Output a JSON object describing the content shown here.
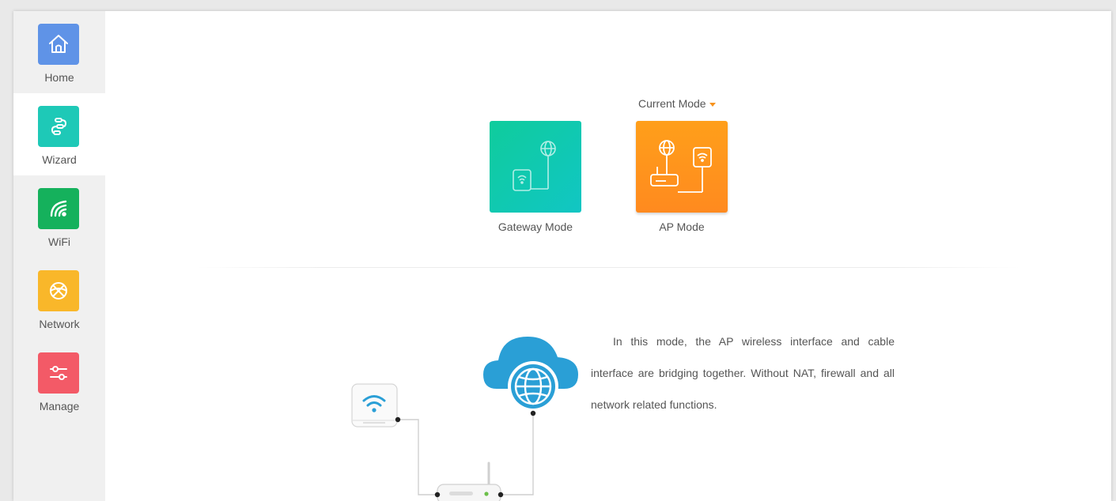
{
  "sidebar": {
    "items": [
      {
        "label": "Home",
        "icon": "home-icon",
        "color": "#5f93e7"
      },
      {
        "label": "Wizard",
        "icon": "wizard-icon",
        "color": "#1ec9b7",
        "active": true
      },
      {
        "label": "WiFi",
        "icon": "wifi-icon",
        "color": "#15b15c"
      },
      {
        "label": "Network",
        "icon": "network-icon",
        "color": "#f9b72a"
      },
      {
        "label": "Manage",
        "icon": "manage-icon",
        "color": "#f35a67"
      }
    ]
  },
  "modes": {
    "current_label": "Current Mode",
    "gateway_label": "Gateway Mode",
    "ap_label": "AP Mode",
    "selected": "AP Mode"
  },
  "description": "In this mode, the AP wireless interface and cable interface are bridging together. Without NAT, firewall and all network related functions.",
  "colors": {
    "accent": "#f7931e",
    "gateway_card": "#11c6c4",
    "ap_card": "#ff8f1f",
    "cloud": "#2a9fd6"
  }
}
